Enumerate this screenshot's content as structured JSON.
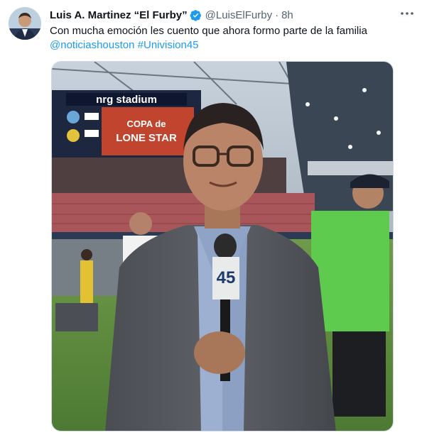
{
  "author": {
    "name": "Luis A. Martinez “El Furby”",
    "handle": "@LuisElFurby",
    "time": "8h"
  },
  "tweet": {
    "line1": "Con mucha emoción les cuento que ahora formo parte de la familia",
    "mention": "@noticiashouston",
    "hashtag": "#Univision45"
  },
  "photo": {
    "stadium_sign": "nrg stadium",
    "screen_text_1": "COPA de",
    "screen_text_2": "LONE STAR",
    "mic_flag": "45"
  },
  "colors": {
    "accent": "#1d9bf0",
    "secondary_text": "#536471"
  },
  "icons": {
    "verified": "verified-badge-icon",
    "more": "more-dots-icon"
  }
}
